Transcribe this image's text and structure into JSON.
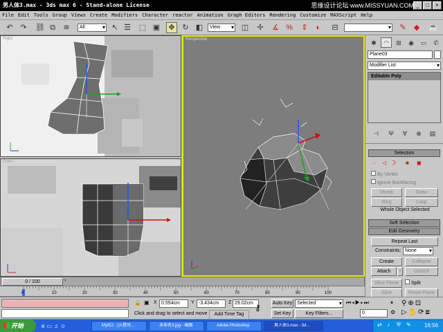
{
  "titlebar": {
    "title": "男人体3.max - 3ds max 6 - Stand-alone License",
    "watermark": "思缘设计论坛 www.MISSYUAN.COM",
    "btn_min": "_",
    "btn_max": "□",
    "btn_close": "×"
  },
  "menu": [
    "File",
    "Edit",
    "Tools",
    "Group",
    "Views",
    "Create",
    "Modifiers",
    "Character",
    "reactor",
    "Animation",
    "Graph Editors",
    "Rendering",
    "Customize",
    "MAXScript",
    "Help"
  ],
  "toolbar": {
    "selection_filter": "All",
    "coord_system": "View"
  },
  "viewports": {
    "top_left": "Right",
    "bottom_left": "Front",
    "main": "Perspective"
  },
  "panel": {
    "object_name": "Plane03",
    "modifier_list": "Modifier List",
    "stack_item": "Editable Poly",
    "selection": {
      "title": "Selection",
      "by_vertex": "By Vertex",
      "ignore_backfacing": "Ignore Backfacing",
      "shrink": "Shrink",
      "grow": "Grow",
      "ring": "Ring",
      "loop": "Loop",
      "whole_object": "Whole Object Selected"
    },
    "soft_selection": "Soft Selection",
    "edit_geometry": {
      "title": "Edit Geometry",
      "repeat_last": "Repeat Last",
      "constraints_label": "Constraints:",
      "constraints_value": "None",
      "create": "Create",
      "collapse": "Collapse",
      "attach": "Attach",
      "detach": "Detach",
      "slice_plane": "Slice Plane",
      "split": "Split",
      "slice": "Slice",
      "reset_plane": "Reset Plane"
    }
  },
  "timeline": {
    "frame": "0 / 100",
    "ticks": [
      "0",
      "10",
      "20",
      "30",
      "40",
      "50",
      "60",
      "70",
      "80",
      "90",
      "100"
    ]
  },
  "status": {
    "prompt": "Click and drag to select and move",
    "add_time_tag": "Add Time Tag",
    "x": "0.554cm",
    "y": "-3.434cm",
    "z": "29.02cm",
    "auto_key": "Auto Key",
    "selected": "Selected",
    "set_key": "Set Key",
    "key_filters": "Key Filters...",
    "frame_field": "0"
  },
  "taskbar": {
    "start": "开始",
    "tasks": [
      "MyIE2 - [火星时...",
      "未命名3.jpg - 画图",
      "Adobe Photoshop",
      "男人体3.max - 3d..."
    ],
    "clock": "16:56"
  },
  "colors": {
    "viewport_bg": "#7d7d7d",
    "active_border": "#e8e800",
    "taskbar": "#245edb",
    "start": "#3c9a3c"
  }
}
